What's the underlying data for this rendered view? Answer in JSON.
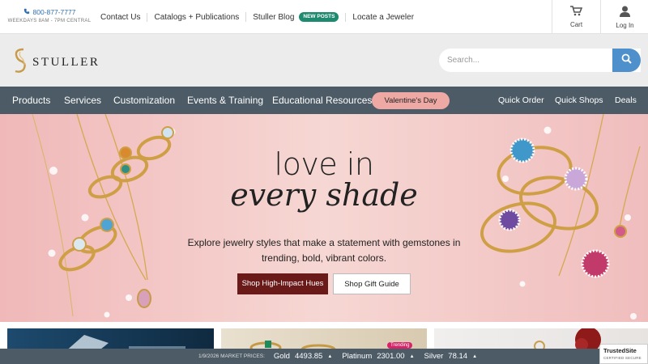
{
  "topbar": {
    "phone": "800-877-7777",
    "hours": "WEEKDAYS 8AM - 7PM CENTRAL",
    "links": [
      "Contact Us",
      "Catalogs + Publications",
      "Stuller Blog",
      "Locate a Jeweler"
    ],
    "blog_badge": "NEW POSTS",
    "cart_label": "Cart",
    "login_label": "Log In"
  },
  "header": {
    "logo_text": "STULLER",
    "search_placeholder": "Search..."
  },
  "nav": {
    "items": [
      "Products",
      "Services",
      "Customization",
      "Events & Training",
      "Educational Resources"
    ],
    "highlight": "Valentine's Day",
    "right_items": [
      "Quick Order",
      "Quick Shops",
      "Deals"
    ]
  },
  "hero": {
    "title_line1": "love in",
    "title_line2": "every shade",
    "subtitle_line1": "Explore jewelry styles that make a statement with gemstones in",
    "subtitle_line2": "trending, bold, vibrant colors.",
    "primary_button": "Shop High-Impact Hues",
    "secondary_button": "Shop Gift Guide"
  },
  "tiles": {
    "trending_badge": "Trending"
  },
  "ticker": {
    "label": "1/9/2026 MARKET PRICES:",
    "metals": [
      {
        "name": "Gold",
        "price": "4493.85"
      },
      {
        "name": "Platinum",
        "price": "2301.00"
      },
      {
        "name": "Silver",
        "price": "78.14"
      }
    ]
  },
  "trusted": {
    "title": "TrustedSite",
    "subtitle": "CERTIFIED SECURE"
  },
  "colors": {
    "nav_bg": "#4c5b66",
    "accent_blue": "#4d90cb",
    "badge_green": "#1e8a6f",
    "valentine_pink": "#eea9a5",
    "primary_button": "#6b1a1a"
  }
}
